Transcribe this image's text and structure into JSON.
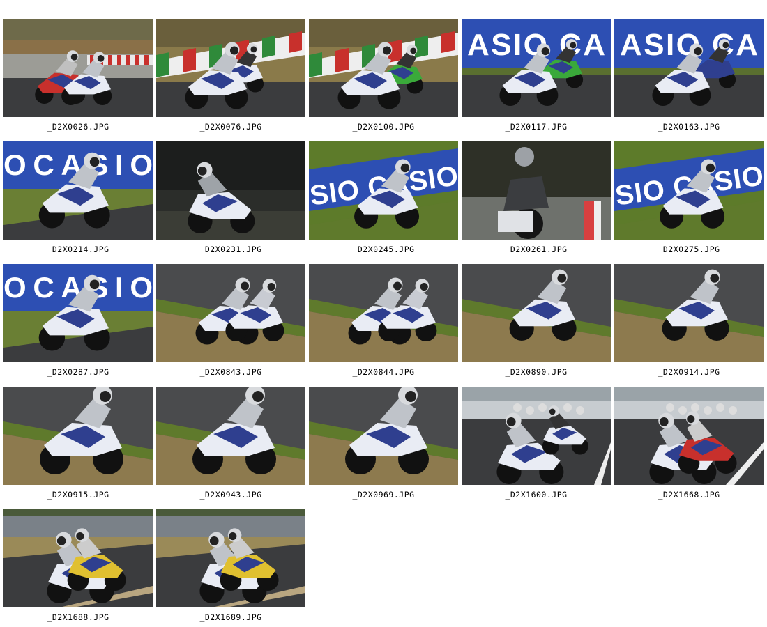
{
  "gallery": {
    "photos": [
      {
        "filename": "_D2X0026.JPG",
        "scene": "pair-straight"
      },
      {
        "filename": "_D2X0076.JPG",
        "scene": "kerb-lean"
      },
      {
        "filename": "_D2X0100.JPG",
        "scene": "kerb-lean-green"
      },
      {
        "filename": "_D2X0117.JPG",
        "scene": "casio-green"
      },
      {
        "filename": "_D2X0163.JPG",
        "scene": "casio-blue"
      },
      {
        "filename": "_D2X0214.JPG",
        "scene": "casio-close"
      },
      {
        "filename": "_D2X0231.JPG",
        "scene": "dark-lean"
      },
      {
        "filename": "_D2X0245.JPG",
        "scene": "casio-grass"
      },
      {
        "filename": "_D2X0261.JPG",
        "scene": "rear-view"
      },
      {
        "filename": "_D2X0275.JPG",
        "scene": "casio-grass"
      },
      {
        "filename": "_D2X0287.JPG",
        "scene": "casio-close"
      },
      {
        "filename": "_D2X0843.JPG",
        "scene": "side-pair"
      },
      {
        "filename": "_D2X0844.JPG",
        "scene": "side-pair"
      },
      {
        "filename": "_D2X0890.JPG",
        "scene": "side-solo"
      },
      {
        "filename": "_D2X0914.JPG",
        "scene": "side-solo"
      },
      {
        "filename": "_D2X0915.JPG",
        "scene": "side-big"
      },
      {
        "filename": "_D2X0943.JPG",
        "scene": "side-big"
      },
      {
        "filename": "_D2X0969.JPG",
        "scene": "side-big"
      },
      {
        "filename": "_D2X1600.JPG",
        "scene": "pack-start"
      },
      {
        "filename": "_D2X1668.JPG",
        "scene": "pack-red"
      },
      {
        "filename": "_D2X1688.JPG",
        "scene": "pair-yellow"
      },
      {
        "filename": "_D2X1689.JPG",
        "scene": "pair-yellow"
      }
    ]
  },
  "palette": {
    "asphalt": "#3b3c3e",
    "grass": "#5f7a2c",
    "dry_grass": "#8d7a4e",
    "casio_blue": "#2d4fb3",
    "bike_white": "#e9ecf4",
    "bike_blue": "#2f3f8f",
    "kerb_red": "#c8302c",
    "kerb_green": "#2f8a3a",
    "dark_bg": "#1c1e1d"
  }
}
